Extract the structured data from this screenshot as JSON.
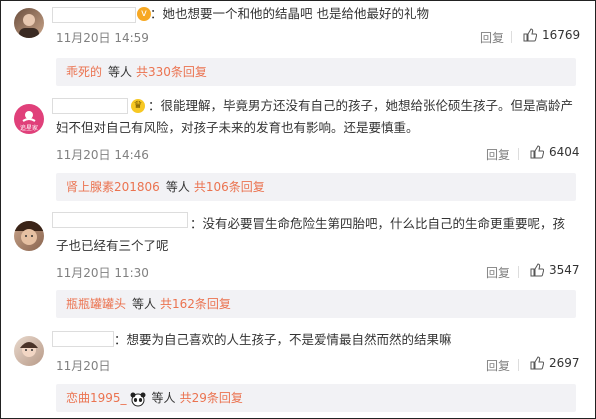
{
  "comments": [
    {
      "text": "：她也想要一个和他的结晶吧 也是给他最好的礼物",
      "time": "11月20日 14:59",
      "reply": "回复",
      "likes": "16769",
      "sub": {
        "user": "乖死的",
        "etc": "等人",
        "count": "共330条回复"
      }
    },
    {
      "text": "：很能理解，毕竟男方还没有自己的孩子，她想给张伦硕生孩子。但是高龄产妇不但对自己有风险，对孩子未来的发育也有影响。还是要慎重。",
      "avatar_text": "追星家",
      "time": "11月20日 14:46",
      "reply": "回复",
      "likes": "6404",
      "sub": {
        "user": "肾上腺素201806",
        "etc": "等人",
        "count": "共106条回复"
      }
    },
    {
      "text": "：没有必要冒生命危险生第四胎吧，什么比自己的生命更重要呢，孩子也已经有三个了呢",
      "time": "11月20日 11:30",
      "reply": "回复",
      "likes": "3547",
      "sub": {
        "user": "瓶瓶罐罐头",
        "etc": "等人",
        "count": "共162条回复"
      }
    },
    {
      "text": "：想要为自己喜欢的人生孩子，不是爱情最自然而然的结果嘛",
      "time": "11月20日",
      "reply": "回复",
      "likes": "2697",
      "sub": {
        "user": "恋曲1995_",
        "etc": "等人",
        "count": "共29条回复"
      }
    }
  ],
  "colors": {
    "link": "#eb7350",
    "muted": "#808080",
    "subbar_bg": "#f2f2f5",
    "badge": "#f7a823"
  }
}
